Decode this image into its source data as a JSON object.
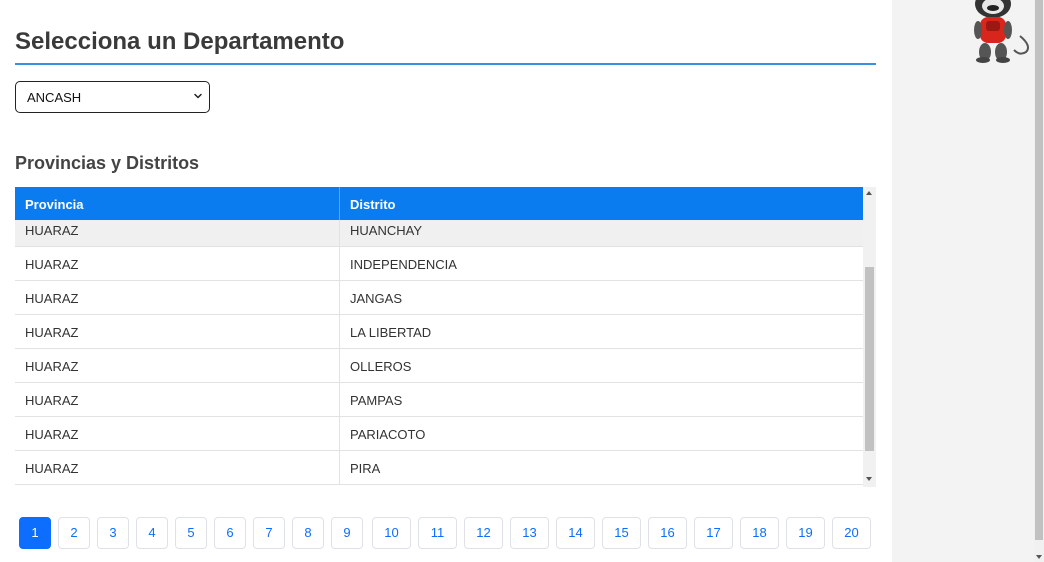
{
  "page": {
    "title": "Selecciona un Departamento",
    "department_select": {
      "value": "ANCASH"
    },
    "section_title": "Provincias y Distritos"
  },
  "table": {
    "columns": [
      "Provincia",
      "Distrito"
    ],
    "rows": [
      [
        "HUARAZ",
        "HUANCHAY"
      ],
      [
        "HUARAZ",
        "INDEPENDENCIA"
      ],
      [
        "HUARAZ",
        "JANGAS"
      ],
      [
        "HUARAZ",
        "LA LIBERTAD"
      ],
      [
        "HUARAZ",
        "OLLEROS"
      ],
      [
        "HUARAZ",
        "PAMPAS"
      ],
      [
        "HUARAZ",
        "PARIACOTO"
      ],
      [
        "HUARAZ",
        "PIRA"
      ]
    ],
    "scroll_position": 0.35
  },
  "pagination": {
    "pages": [
      "1",
      "2",
      "3",
      "4",
      "5",
      "6",
      "7",
      "8",
      "9",
      "10",
      "11",
      "12",
      "13",
      "14",
      "15",
      "16",
      "17",
      "18",
      "19",
      "20"
    ],
    "active": "1"
  },
  "colors": {
    "accent": "#0b7cf0",
    "page_active": "#0d6efd",
    "title_rule": "#3b8fe0"
  },
  "icons": {
    "select_arrow": "chevron-down-icon",
    "mascot": "monkey-mascot-icon"
  }
}
